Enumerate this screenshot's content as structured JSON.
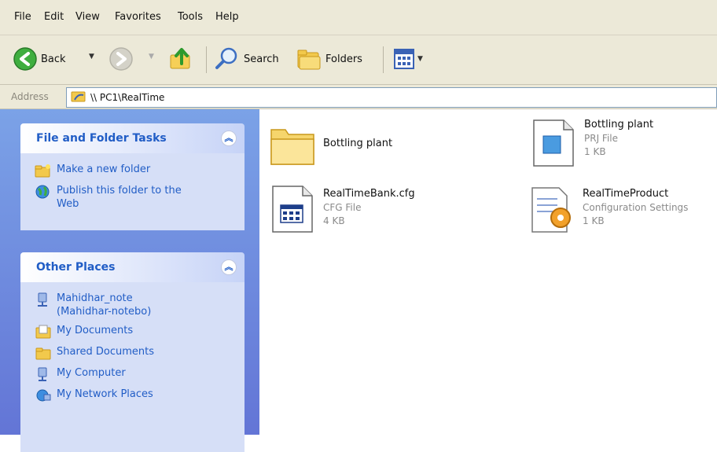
{
  "menu": [
    "File",
    "Edit",
    "View",
    "Favorites",
    "Tools",
    "Help"
  ],
  "toolbar": {
    "back_label": "Back",
    "search_label": "Search",
    "folders_label": "Folders"
  },
  "address": {
    "label": "Address",
    "path": "\\\\ PC1\\RealTime"
  },
  "sidebar": {
    "tasks": {
      "title": "File and Folder Tasks",
      "items": [
        {
          "label": "Make a new folder",
          "icon": "new-folder-icon"
        },
        {
          "label": "Publish this folder to the Web",
          "icon": "globe-icon"
        }
      ]
    },
    "places": {
      "title": "Other Places",
      "items": [
        {
          "label": "Mahidhar_note (Mahidhar-notebo)",
          "icon": "network-computer-icon"
        },
        {
          "label": "My Documents",
          "icon": "my-documents-icon"
        },
        {
          "label": "Shared Documents",
          "icon": "shared-documents-icon"
        },
        {
          "label": "My Computer",
          "icon": "my-computer-icon"
        },
        {
          "label": "My Network Places",
          "icon": "network-places-icon"
        }
      ]
    }
  },
  "files": [
    {
      "name": "Bottling plant",
      "type": "",
      "size": "",
      "icon": "folder-icon"
    },
    {
      "name": "Bottling plant",
      "type": "PRJ File",
      "size": "1 KB",
      "icon": "prj-file-icon"
    },
    {
      "name": "RealTimeBank.cfg",
      "type": "CFG File",
      "size": "4 KB",
      "icon": "cfg-file-icon"
    },
    {
      "name": "RealTimeProduct",
      "type": "Configuration Settings",
      "size": "1 KB",
      "icon": "config-settings-icon"
    }
  ]
}
